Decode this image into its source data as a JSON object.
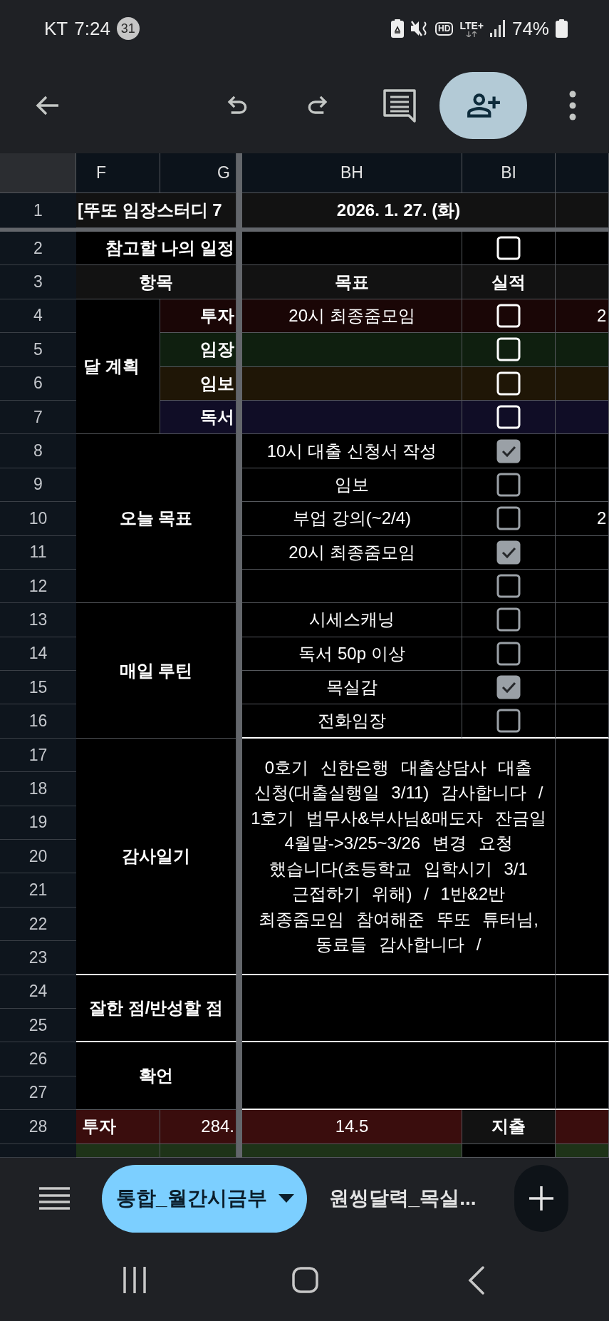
{
  "status_bar": {
    "carrier": "KT",
    "time": "7:24",
    "badge": "31",
    "hd": "HD",
    "network": "LTE+",
    "battery": "74%"
  },
  "column_headers": [
    "F",
    "G",
    "BH",
    "BI"
  ],
  "row_numbers": [
    "1",
    "2",
    "3",
    "4",
    "5",
    "6",
    "7",
    "8",
    "9",
    "10",
    "11",
    "12",
    "13",
    "14",
    "15",
    "16",
    "17",
    "18",
    "19",
    "20",
    "21",
    "22",
    "23",
    "24",
    "25",
    "26",
    "27",
    "28"
  ],
  "sheet": {
    "title": "[뚜또 임장스터디 7",
    "date": "2026. 1. 27. (화)",
    "schedule": {
      "label": "참고할 나의 일정",
      "checked": false
    },
    "header": {
      "item": "항목",
      "goal": "목표",
      "result": "실적"
    },
    "plan": {
      "label": "달 계획",
      "rows": [
        {
          "category": "투자",
          "goal": "20시 최종줌모임",
          "checked": false,
          "color": "#1a0606",
          "next_column": "2"
        },
        {
          "category": "임장",
          "checked": false,
          "color": "#0f1f0f"
        },
        {
          "category": "임보",
          "checked": false,
          "color": "#1f1606"
        },
        {
          "category": "독서",
          "checked": false,
          "color": "#100d26"
        }
      ]
    },
    "sections": [
      {
        "label": "오늘 목표",
        "rows": [
          {
            "goal": "10시 대출 신청서 작성",
            "checked": true
          },
          {
            "goal": "임보",
            "checked": false
          },
          {
            "goal": "부업 강의(~2/4)",
            "checked": false,
            "next_column": "2"
          },
          {
            "goal": "20시 최종줌모임",
            "checked": true
          },
          {
            "checked": false
          }
        ]
      },
      {
        "label": "매일 루틴",
        "rows": [
          {
            "goal": "시세스캐닝",
            "checked": false
          },
          {
            "goal": "독서 50p 이상",
            "checked": false
          },
          {
            "goal": "목실감",
            "checked": true
          },
          {
            "goal": "전화임장",
            "checked": false
          }
        ]
      }
    ],
    "notes": [
      {
        "label": "감사일기",
        "text": "0호기 신한은행 대출상담사 대출 신청(대출실행일 3/11) 감사합니다 / 1호기 법무사&부사님&매도자 잔금일 4월말->3/25~3/26 변경 요청 했습니다(초등학교 입학시기 3/1 근접하기 위해) / 1반&2반 최종줌모임 참여해준 뚜또 튜터님, 동료들 감사합니다 /"
      },
      {
        "label": "잘한 점/반성할 점"
      },
      {
        "label": "확언"
      }
    ],
    "totals": [
      {
        "label": "투자",
        "value": "284.",
        "goal": "14.5",
        "result": "지출",
        "color": "#3a0d0d"
      },
      {
        "color": "#1e3318"
      }
    ]
  },
  "sheet_tabs": [
    {
      "label": "통합_월간시금부",
      "selected": true
    },
    {
      "label": "원씽달력_목실...",
      "selected": false
    }
  ]
}
